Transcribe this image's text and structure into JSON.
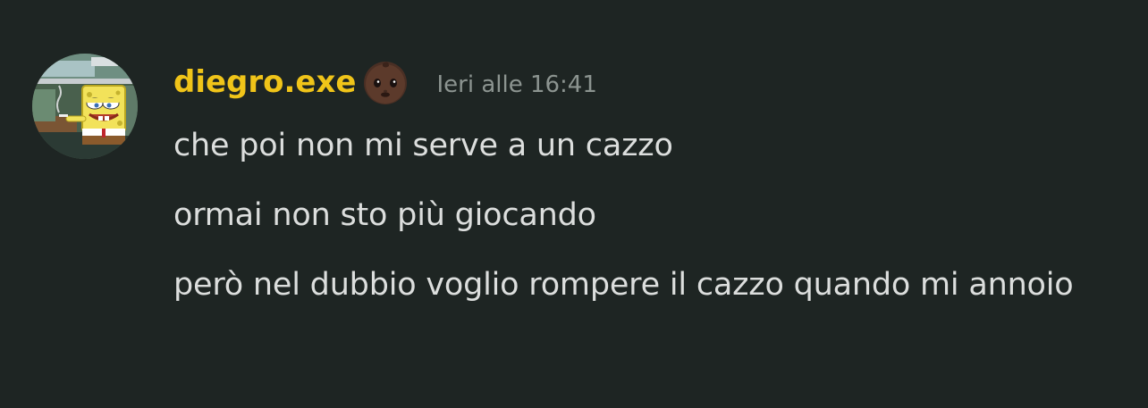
{
  "message": {
    "author": {
      "username": "diegro.exe",
      "emoji_icon": "baby-icon",
      "username_color": "#f0c419"
    },
    "timestamp": "Ieri alle 16:41",
    "lines": [
      "che poi non mi serve a un cazzo",
      "ormai non sto più giocando",
      "però nel dubbio voglio rompere il cazzo quando mi annoio"
    ]
  },
  "colors": {
    "background": "#1e2523",
    "text": "#dcdedd",
    "timestamp": "#8c9490"
  }
}
